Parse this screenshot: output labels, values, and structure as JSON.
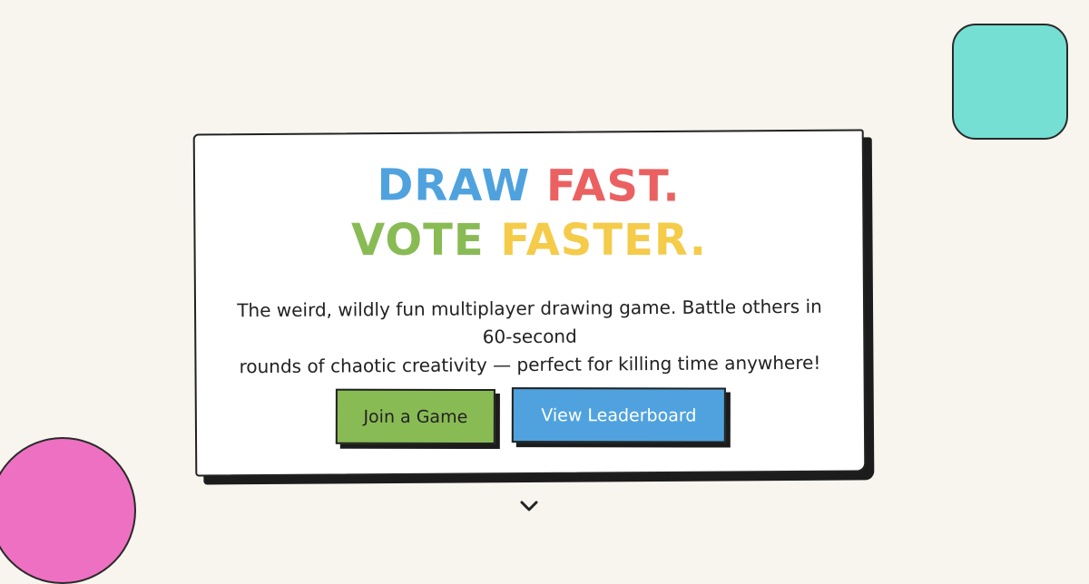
{
  "hero": {
    "headline_line1_part1": "DRAW",
    "headline_line1_part2": "FAST.",
    "headline_line2_part1": "VOTE",
    "headline_line2_part2": "FASTER.",
    "tagline_line1": "The weird, wildly fun multiplayer drawing game. Battle others in 60-second",
    "tagline_line2": "rounds of chaotic creativity — perfect for killing time anywhere!"
  },
  "buttons": {
    "join_label": "Join a Game",
    "leaderboard_label": "View Leaderboard"
  },
  "icons": {
    "scroll_down": "chevron-down-icon"
  },
  "colors": {
    "background": "#f7f5ee",
    "blue": "#4fa2de",
    "red": "#eb6161",
    "green": "#89bb55",
    "yellow": "#f5cb4a",
    "teal_deco": "#75dfd3",
    "pink_deco": "#ee70c2"
  }
}
